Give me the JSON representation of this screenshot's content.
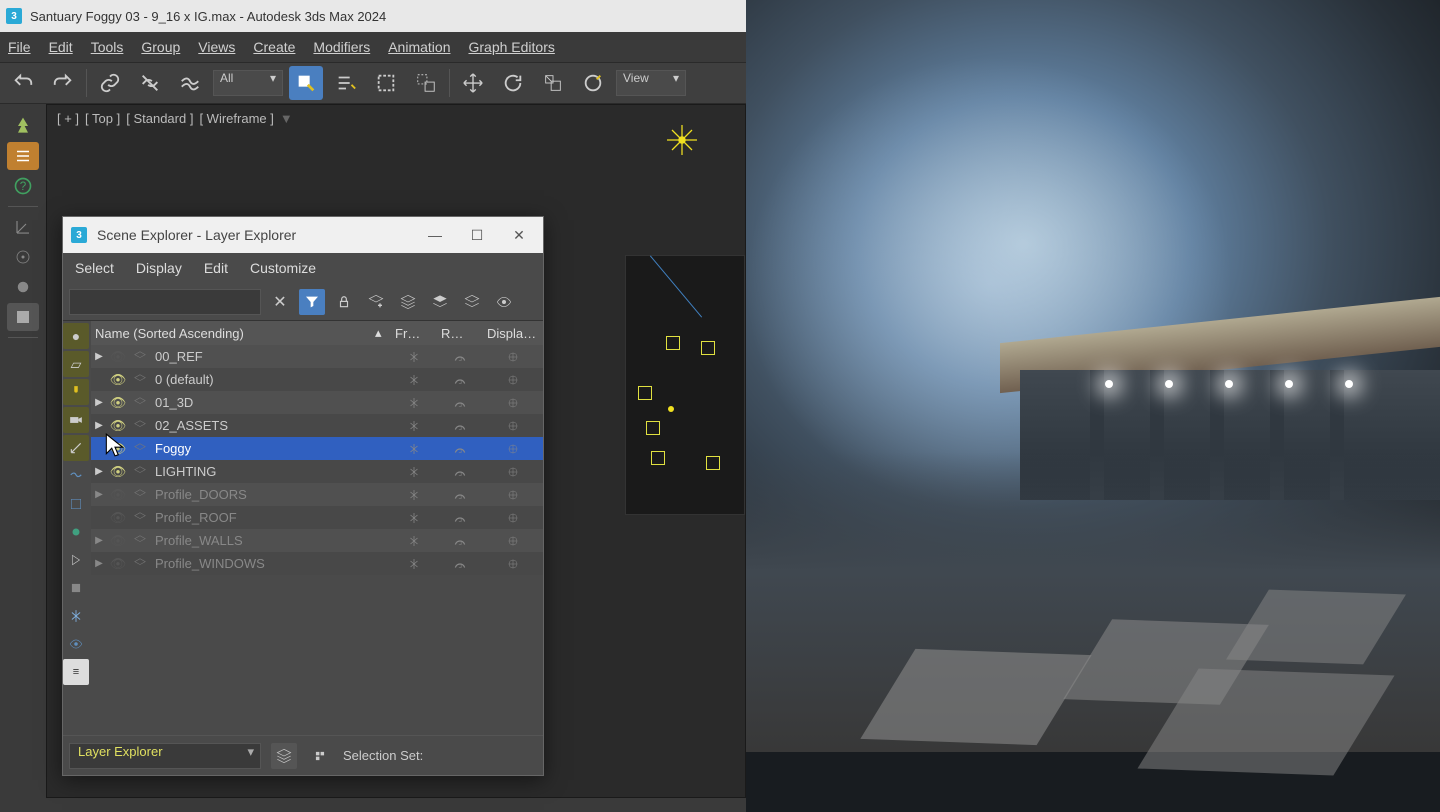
{
  "title": "Santuary Foggy 03 - 9_16 x IG.max - Autodesk 3ds Max 2024",
  "menu": [
    "File",
    "Edit",
    "Tools",
    "Group",
    "Views",
    "Create",
    "Modifiers",
    "Animation",
    "Graph Editors"
  ],
  "toolbar": {
    "select_filter": "All",
    "ref_coord": "View"
  },
  "viewport": {
    "label_parts": [
      "[ + ]",
      "[ Top ]",
      "[ Standard ]",
      "[ Wireframe ]"
    ]
  },
  "explorer": {
    "title": "Scene Explorer - Layer Explorer",
    "menu": [
      "Select",
      "Display",
      "Edit",
      "Customize"
    ],
    "header": {
      "name": "Name (Sorted Ascending)",
      "c1": "Fr…",
      "c2": "R…",
      "c3": "Displa…"
    },
    "rows": [
      {
        "name": "00_REF",
        "expand": true,
        "visible": false,
        "dim": false,
        "selected": false
      },
      {
        "name": "0 (default)",
        "expand": false,
        "visible": true,
        "dim": false,
        "selected": false
      },
      {
        "name": "01_3D",
        "expand": true,
        "visible": true,
        "dim": false,
        "selected": false
      },
      {
        "name": "02_ASSETS",
        "expand": true,
        "visible": true,
        "dim": false,
        "selected": false
      },
      {
        "name": "Foggy",
        "expand": false,
        "visible": true,
        "dim": false,
        "selected": true
      },
      {
        "name": "LIGHTING",
        "expand": true,
        "visible": true,
        "dim": false,
        "selected": false
      },
      {
        "name": "Profile_DOORS",
        "expand": true,
        "visible": false,
        "dim": true,
        "selected": false
      },
      {
        "name": "Profile_ROOF",
        "expand": false,
        "visible": false,
        "dim": true,
        "selected": false
      },
      {
        "name": "Profile_WALLS",
        "expand": true,
        "visible": false,
        "dim": true,
        "selected": false
      },
      {
        "name": "Profile_WINDOWS",
        "expand": true,
        "visible": false,
        "dim": true,
        "selected": false
      }
    ],
    "mode": "Layer Explorer",
    "selection_label": "Selection Set:"
  }
}
